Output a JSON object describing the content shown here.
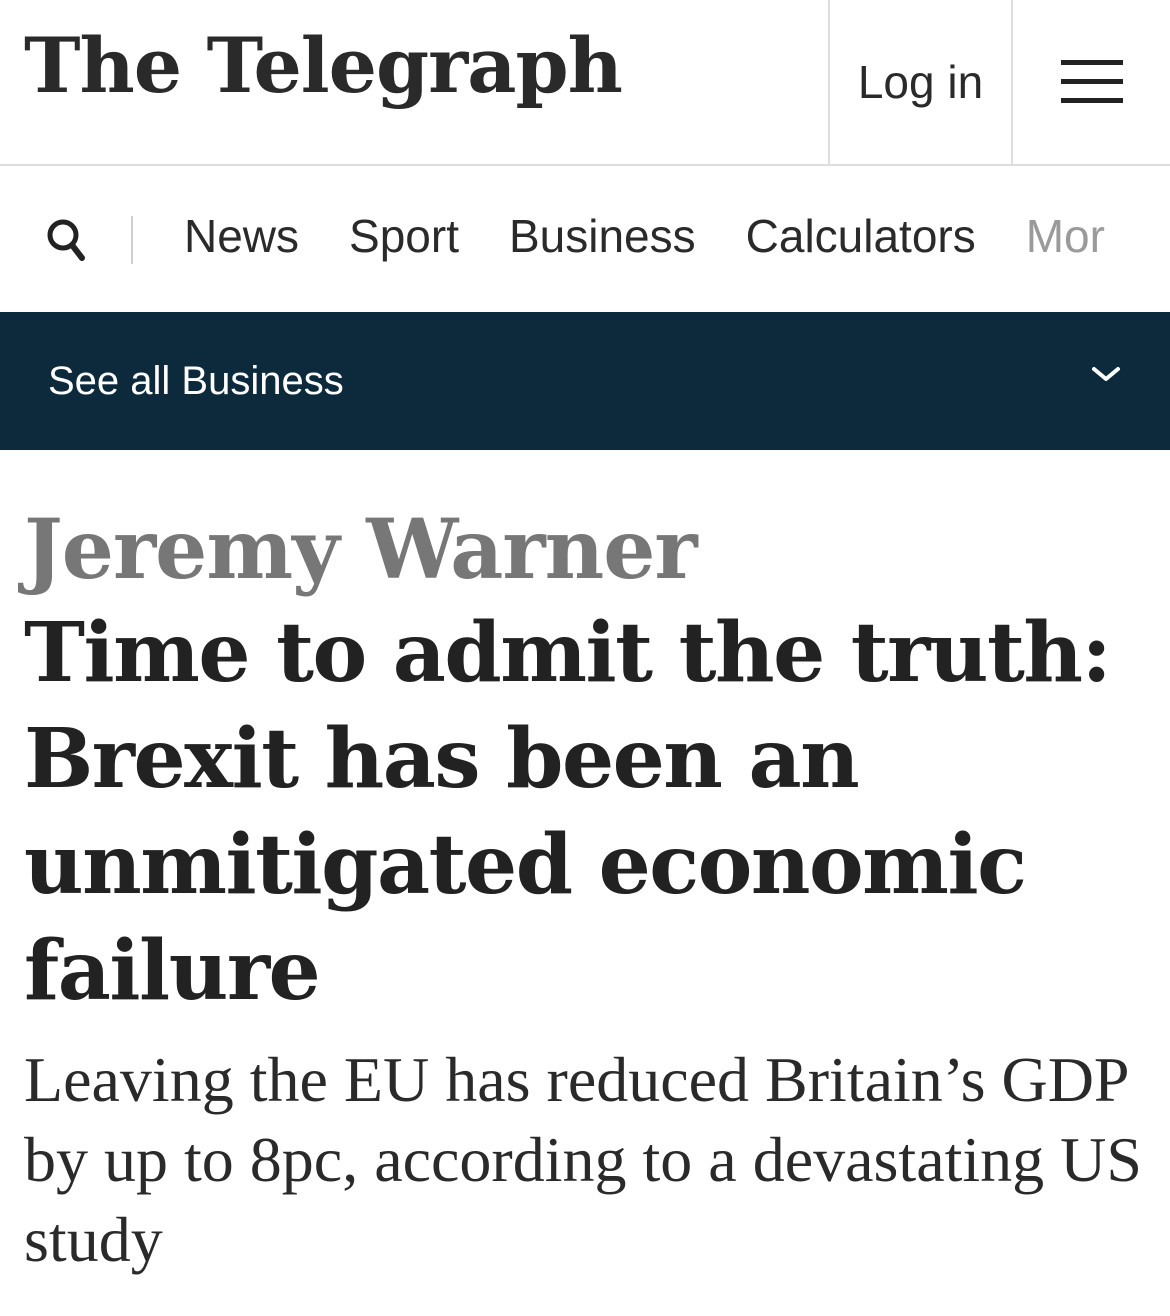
{
  "header": {
    "logo_text": "The Telegraph",
    "login_label": "Log in",
    "menu_icon": "hamburger-menu-icon"
  },
  "nav": {
    "search_icon": "search-icon",
    "items": [
      "News",
      "Sport",
      "Business",
      "Calculators",
      "Mor"
    ]
  },
  "section_bar": {
    "label": "See all Business",
    "icon": "chevron-down-icon",
    "background_color": "#0c2a3c"
  },
  "article": {
    "author": "Jeremy Warner",
    "headline": "Time to admit the truth: Brexit has been an unmitigated economic failure",
    "standfirst": "Leaving the EU has reduced Britain’s GDP by up to 8pc, according to a devastating US study"
  }
}
